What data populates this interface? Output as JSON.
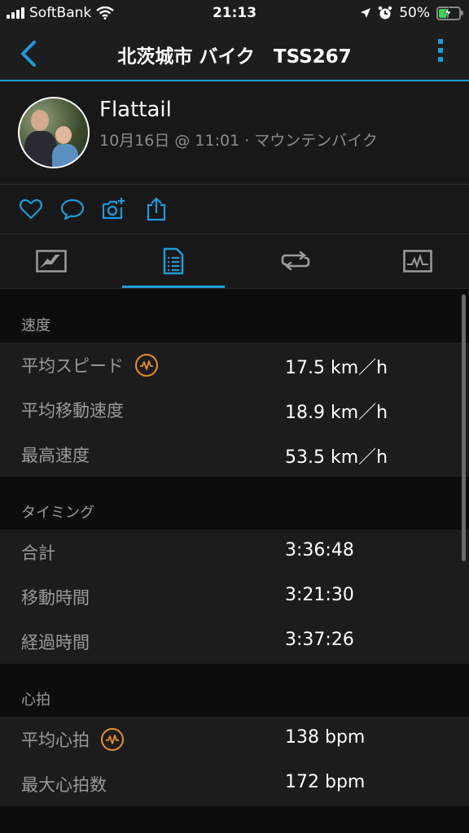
{
  "status_bar": {
    "carrier": "SoftBank",
    "time": "21:13",
    "battery_percent": "50%",
    "battery_level": 0.5,
    "icons": [
      "signal-icon",
      "wifi-icon",
      "location-icon",
      "alarm-icon",
      "battery-charging-icon"
    ]
  },
  "header": {
    "title": "北茨城市 バイク　TSS267",
    "back_icon": "chevron-left-icon",
    "more_icon": "more-vertical-icon"
  },
  "profile": {
    "name": "Flattail",
    "subtitle": "10月16日 @ 11:01 · マウンテンバイク"
  },
  "actions": [
    "like-icon",
    "comment-icon",
    "add-photo-icon",
    "share-icon"
  ],
  "tabs": [
    {
      "icon": "map-icon",
      "active": false
    },
    {
      "icon": "details-list-icon",
      "active": true
    },
    {
      "icon": "laps-icon",
      "active": false
    },
    {
      "icon": "chart-icon",
      "active": false
    }
  ],
  "sections": {
    "speed": {
      "title": "速度",
      "rows": [
        {
          "label": "平均スピード",
          "value": "17.5 km／h"
        },
        {
          "label": "平均移動速度",
          "value": "18.9 km／h"
        },
        {
          "label": "最高速度",
          "value": "53.5 km／h"
        }
      ]
    },
    "timing": {
      "title": "タイミング",
      "rows": [
        {
          "label": "合計",
          "value": "3:36:48"
        },
        {
          "label": "移動時間",
          "value": "3:21:30"
        },
        {
          "label": "経過時間",
          "value": "3:37:26"
        }
      ]
    },
    "heart": {
      "title": "心拍",
      "rows": [
        {
          "label": "平均心拍",
          "value": "138 bpm"
        },
        {
          "label": "最大心拍数",
          "value": "172 bpm"
        }
      ]
    }
  },
  "colors": {
    "accent": "#1e9bd7",
    "badge": "#e8902a",
    "battery": "#3cd256"
  }
}
